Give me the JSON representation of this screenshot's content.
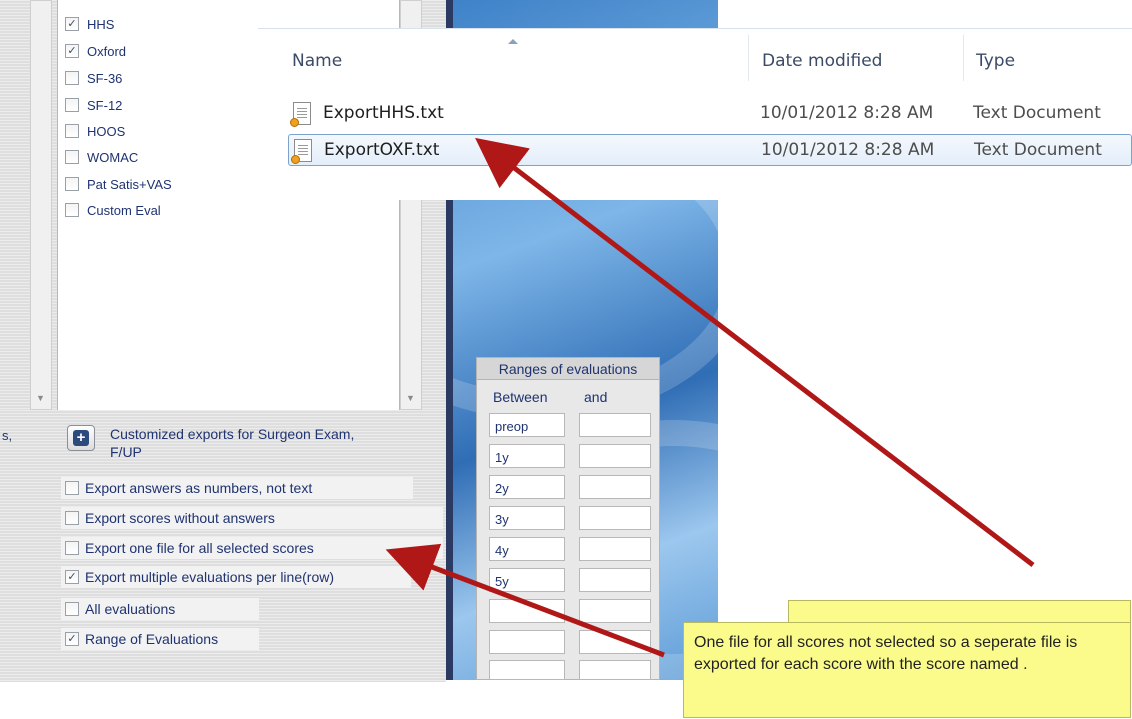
{
  "scores_list": {
    "items": [
      {
        "label": "HHS",
        "checked": true
      },
      {
        "label": "Oxford",
        "checked": true
      },
      {
        "label": "SF-36",
        "checked": false
      },
      {
        "label": "SF-12",
        "checked": false
      },
      {
        "label": "HOOS",
        "checked": false
      },
      {
        "label": "WOMAC",
        "checked": false
      },
      {
        "label": "Pat Satis+VAS",
        "checked": false
      },
      {
        "label": "Custom Eval",
        "checked": false
      }
    ],
    "scroll_down_glyph": "▼"
  },
  "explorer": {
    "columns": {
      "name": "Name",
      "date_modified": "Date modified",
      "type": "Type"
    },
    "files": [
      {
        "name": "ExportHHS.txt",
        "date": "10/01/2012 8:28 AM",
        "type": "Text Document",
        "selected": false
      },
      {
        "name": "ExportOXF.txt",
        "date": "10/01/2012 8:28 AM",
        "type": "Text Document",
        "selected": true
      }
    ],
    "file_icon": "text-file-icon"
  },
  "export_options": {
    "truncated_label": "s,",
    "customized_exports_label": "Customized exports for Surgeon Exam, F/UP",
    "plus_glyph": "+",
    "options": [
      {
        "label": "Export answers as numbers, not text",
        "checked": false
      },
      {
        "label": "Export scores without answers",
        "checked": false
      },
      {
        "label": "Export one file for all selected scores",
        "checked": false
      },
      {
        "label": "Export multiple evaluations per line(row)",
        "checked": true
      },
      {
        "label": "All evaluations",
        "checked": false
      },
      {
        "label": "Range of Evaluations",
        "checked": true
      }
    ]
  },
  "ranges": {
    "title": "Ranges of evaluations",
    "col_between": "Between",
    "col_and": "and",
    "between_values": [
      "preop",
      "1y",
      "2y",
      "3y",
      "4y",
      "5y",
      "",
      "",
      ""
    ],
    "and_values": [
      "",
      "",
      "",
      "",
      "",
      "",
      "",
      "",
      ""
    ]
  },
  "note": {
    "text": "One file for all scores not selected so a seperate file is exported for each score with the score named ."
  },
  "colors": {
    "arrow": "#b01818",
    "note_bg": "#fbfb8c",
    "label_text": "#1f3370",
    "desktop_blue": "#3f82c8"
  }
}
